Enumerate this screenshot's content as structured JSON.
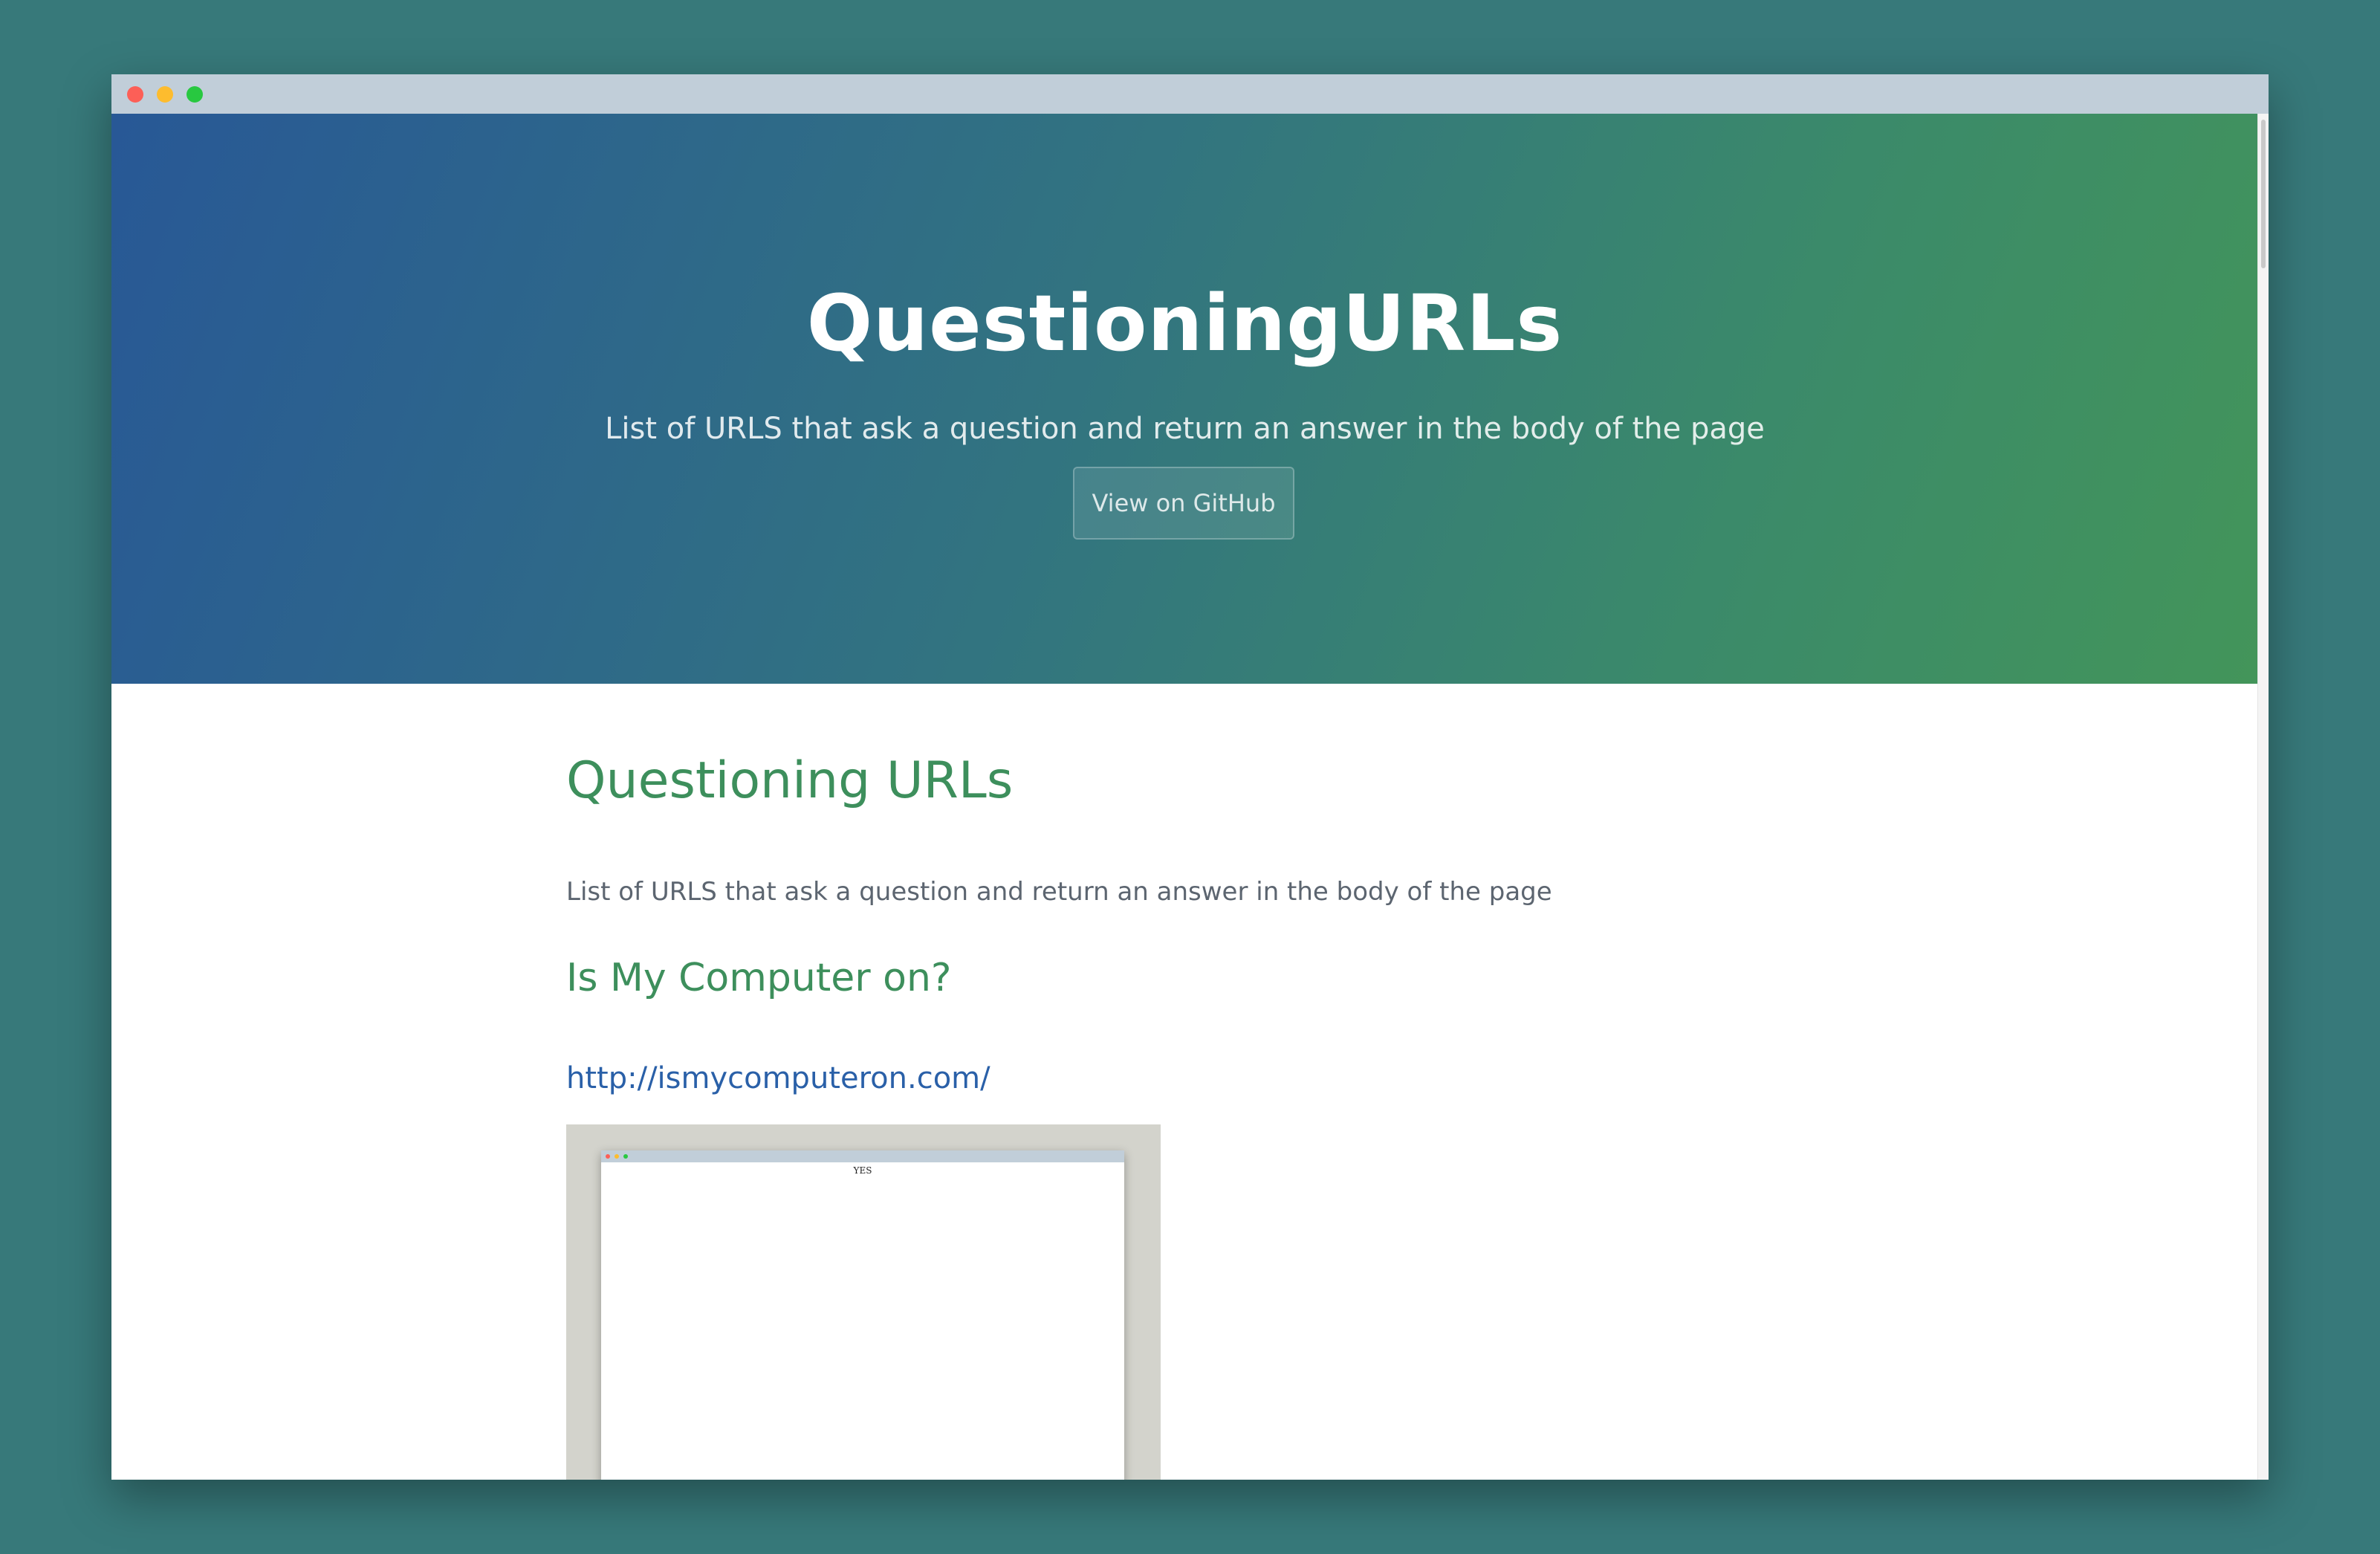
{
  "hero": {
    "title": "QuestioningURLs",
    "tagline": "List of URLS that ask a question and return an answer in the body of the page",
    "button_label": "View on GitHub"
  },
  "content": {
    "title": "Questioning URLs",
    "description": "List of URLS that ask a question and return an answer in the body of the page",
    "sections": [
      {
        "heading": "Is My Computer on?",
        "link": "http://ismycomputeron.com/",
        "preview_text": "YES"
      }
    ]
  },
  "colors": {
    "background": "#37797a",
    "hero_gradient_start": "#285896",
    "hero_gradient_end": "#43955a",
    "heading_green": "#3d8f5c",
    "link_blue": "#2a60a8",
    "titlebar": "#c1ced9"
  }
}
